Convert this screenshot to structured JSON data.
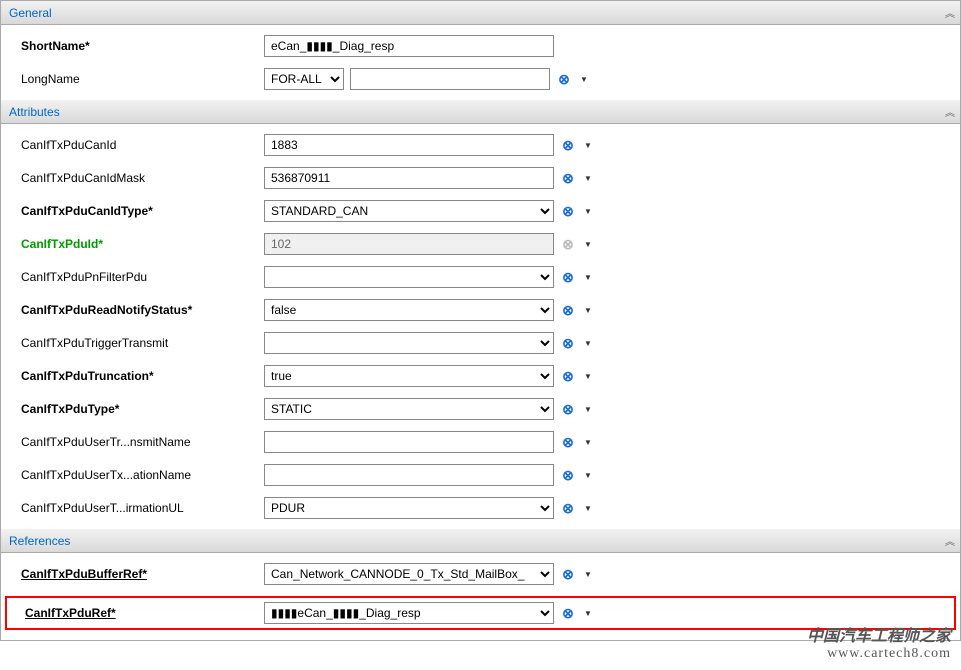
{
  "sections": {
    "general": {
      "title": "General"
    },
    "attributes": {
      "title": "Attributes"
    },
    "references": {
      "title": "References"
    }
  },
  "general": {
    "short_name": {
      "label": "ShortName*",
      "value": "eCan_▮▮▮▮_Diag_resp"
    },
    "long_name": {
      "label": "LongName",
      "select_value": "FOR-ALL",
      "text_value": ""
    }
  },
  "attributes": {
    "can_id": {
      "label": "CanIfTxPduCanId",
      "value": "1883"
    },
    "can_id_mask": {
      "label": "CanIfTxPduCanIdMask",
      "value": "536870911"
    },
    "can_id_type": {
      "label": "CanIfTxPduCanIdType*",
      "value": "STANDARD_CAN"
    },
    "pdu_id": {
      "label": "CanIfTxPduId*",
      "value": "102"
    },
    "pn_filter": {
      "label": "CanIfTxPduPnFilterPdu",
      "value": ""
    },
    "read_notify": {
      "label": "CanIfTxPduReadNotifyStatus*",
      "value": "false"
    },
    "trigger_transmit": {
      "label": "CanIfTxPduTriggerTransmit",
      "value": ""
    },
    "truncation": {
      "label": "CanIfTxPduTruncation*",
      "value": "true"
    },
    "pdu_type": {
      "label": "CanIfTxPduType*",
      "value": "STATIC"
    },
    "user_transmit_name": {
      "label": "CanIfTxPduUserTr...nsmitName",
      "value": ""
    },
    "user_ation_name": {
      "label": "CanIfTxPduUserTx...ationName",
      "value": ""
    },
    "user_irmation_ul": {
      "label": "CanIfTxPduUserT...irmationUL",
      "value": "PDUR"
    }
  },
  "references": {
    "buffer_ref": {
      "label": "CanIfTxPduBufferRef*",
      "value": "Can_Network_CANNODE_0_Tx_Std_MailBox_"
    },
    "pdu_ref": {
      "label": "CanIfTxPduRef*",
      "value": "▮▮▮▮eCan_▮▮▮▮_Diag_resp"
    }
  },
  "watermark": {
    "line1": "中国汽车工程师之家",
    "line2": "www.cartech8.com"
  }
}
